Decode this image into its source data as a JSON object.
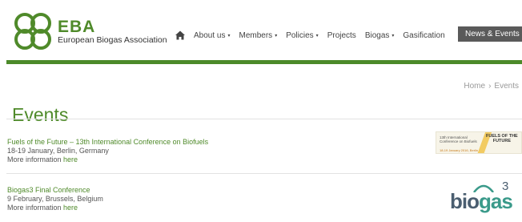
{
  "header": {
    "logo_name": "EBA",
    "logo_subtitle": "European Biogas Association"
  },
  "nav": {
    "items": [
      {
        "label": "About us",
        "has_caret": true
      },
      {
        "label": "Members",
        "has_caret": true
      },
      {
        "label": "Policies",
        "has_caret": true
      },
      {
        "label": "Projects",
        "has_caret": false
      },
      {
        "label": "Biogas",
        "has_caret": true
      },
      {
        "label": "Gasification",
        "has_caret": false
      }
    ],
    "active_label": "News & Events",
    "caret_glyph": "▾"
  },
  "breadcrumb": {
    "home": "Home",
    "separator": "›",
    "current": "Events"
  },
  "page": {
    "title": "Events"
  },
  "events": [
    {
      "title": "Fuels of the Future – 13th International Conference on Biofuels",
      "date_location": "18-19 January, Berlin, Germany",
      "more_prefix": "More information",
      "more_link": "here",
      "thumb": {
        "left_line1": "13th International",
        "left_line2": "Conference on Biofuels",
        "date": "18-19 January 2016, Berlin",
        "right_line1": "FUELS OF THE",
        "right_line2": "FUTURE"
      }
    },
    {
      "title": "Biogas3 Final Conference",
      "date_location": "9 February, Brussels, Belgium",
      "more_prefix": "More information",
      "more_link": "here",
      "logo": {
        "word_a": "bio",
        "word_b": "gas",
        "sup": "3"
      }
    }
  ],
  "colors": {
    "brand_green": "#4f8a2a",
    "bar_green": "#4c8a2a",
    "active_nav_bg": "#5a5a5a"
  }
}
